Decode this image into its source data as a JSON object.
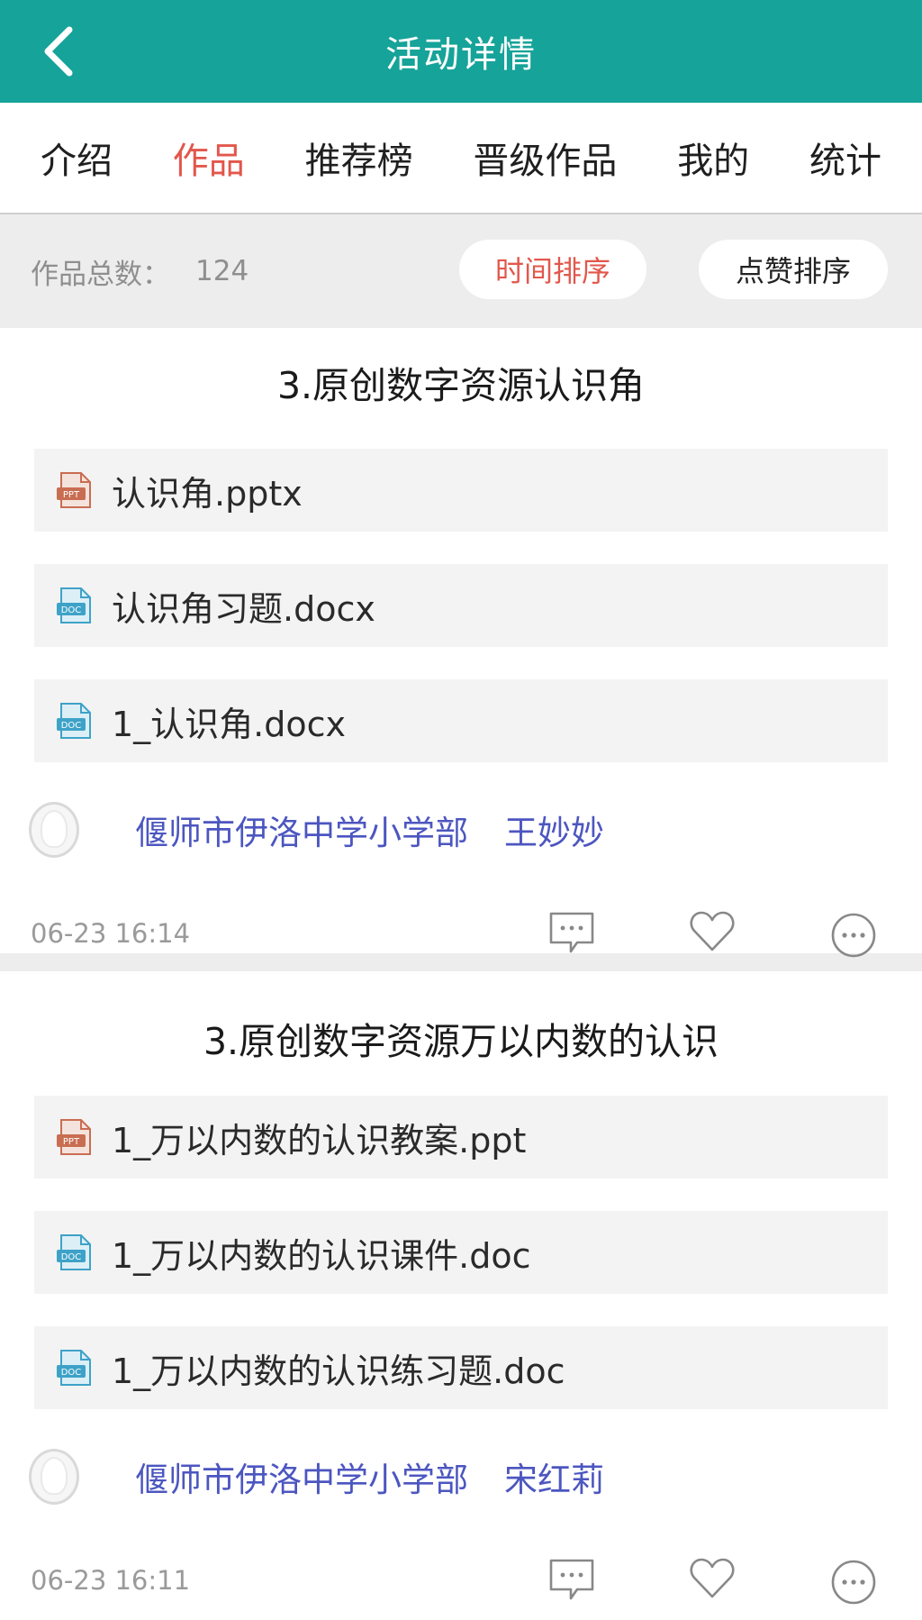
{
  "header": {
    "title": "活动详情"
  },
  "tabs": [
    {
      "label": "介绍",
      "active": false
    },
    {
      "label": "作品",
      "active": true
    },
    {
      "label": "推荐榜",
      "active": false
    },
    {
      "label": "晋级作品",
      "active": false
    },
    {
      "label": "我的",
      "active": false
    },
    {
      "label": "统计",
      "active": false
    }
  ],
  "summary": {
    "label": "作品总数：",
    "count": "124",
    "sort_time_label": "时间排序",
    "sort_like_label": "点赞排序"
  },
  "works": [
    {
      "title": "3.原创数字资源认识角",
      "files": [
        {
          "name": "认识角.pptx",
          "icon": "ppt-file-icon"
        },
        {
          "name": "认识角习题.docx",
          "icon": "doc-file-icon"
        },
        {
          "name": "1_认识角.docx",
          "icon": "doc-file-icon"
        }
      ],
      "school": "偃师市伊洛中学小学部",
      "author": "王妙妙",
      "time": "06-23 16:14"
    },
    {
      "title": "3.原创数字资源万以内数的认识",
      "files": [
        {
          "name": "1_万以内数的认识教案.ppt",
          "icon": "ppt-file-icon"
        },
        {
          "name": "1_万以内数的认识课件.doc",
          "icon": "doc-file-icon"
        },
        {
          "name": "1_万以内数的认识练习题.doc",
          "icon": "doc-file-icon"
        }
      ],
      "school": "偃师市伊洛中学小学部",
      "author": "宋红莉",
      "time": "06-23 16:11"
    }
  ],
  "colors": {
    "app_bar": "#16a399",
    "accent_red": "#e2574c",
    "link_blue": "#4c56c0",
    "ppt_icon": "#c96d52",
    "doc_icon": "#3ea2c8"
  }
}
